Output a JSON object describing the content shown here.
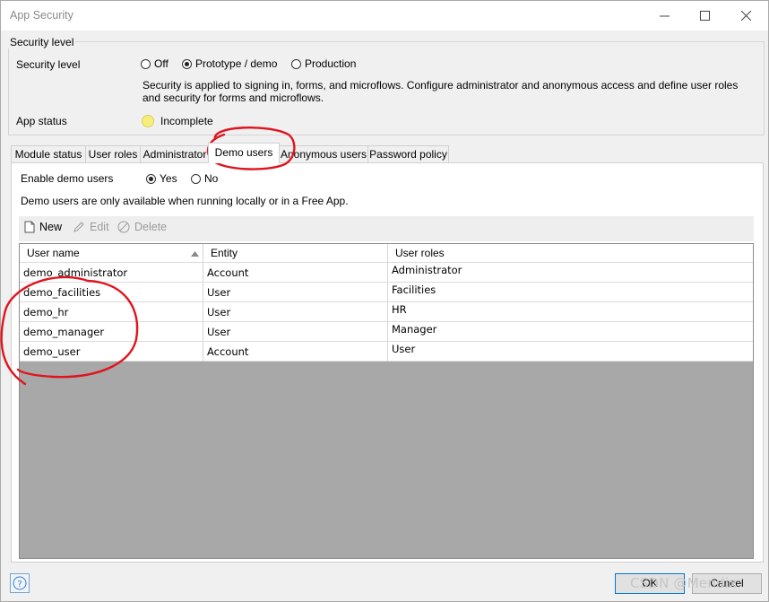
{
  "window": {
    "title": "App Security"
  },
  "security_level": {
    "legend": "Security level",
    "label": "Security level",
    "options": [
      {
        "label": "Off",
        "selected": false
      },
      {
        "label": "Prototype / demo",
        "selected": true
      },
      {
        "label": "Production",
        "selected": false
      }
    ],
    "description": "Security is applied to signing in, forms, and microflows. Configure administrator and anonymous access and define user roles and security for forms and microflows.",
    "app_status_label": "App status",
    "app_status_value": "Incomplete",
    "status_color": "#f7ef7a"
  },
  "tabs": [
    {
      "label": "Module status",
      "active": false
    },
    {
      "label": "User roles",
      "active": false
    },
    {
      "label": "Administrator",
      "active": false
    },
    {
      "label": "Demo users",
      "active": true
    },
    {
      "label": "Anonymous users",
      "active": false
    },
    {
      "label": "Password policy",
      "active": false
    }
  ],
  "demo_users": {
    "enable_label": "Enable demo users",
    "enable_options": [
      {
        "label": "Yes",
        "selected": true
      },
      {
        "label": "No",
        "selected": false
      }
    ],
    "note": "Demo users are only available when running locally or in a Free App.",
    "toolbar": {
      "new": "New",
      "edit": "Edit",
      "delete": "Delete"
    },
    "columns": [
      "User name",
      "Entity",
      "User roles"
    ],
    "rows": [
      {
        "user_name": "demo_administrator",
        "entity": "Account",
        "roles": "Administrator"
      },
      {
        "user_name": "demo_facilities",
        "entity": "User",
        "roles": "Facilities"
      },
      {
        "user_name": "demo_hr",
        "entity": "User",
        "roles": "HR"
      },
      {
        "user_name": "demo_manager",
        "entity": "User",
        "roles": "Manager"
      },
      {
        "user_name": "demo_user",
        "entity": "Account",
        "roles": "User"
      }
    ]
  },
  "footer": {
    "ok": "OK",
    "cancel": "Cancel",
    "help_icon": "question-icon"
  },
  "watermark": "CSDN @Mendix",
  "annotation_color": "#e0141e"
}
